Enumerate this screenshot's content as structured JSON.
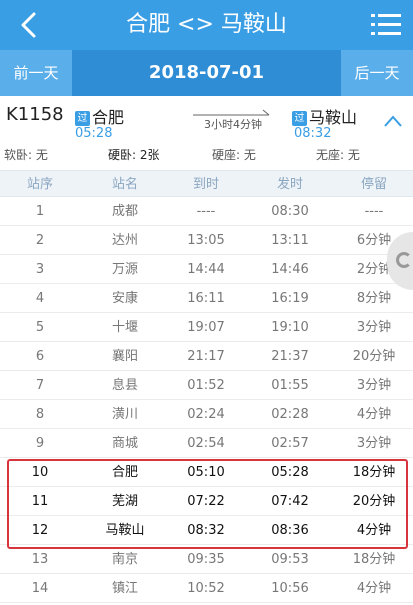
{
  "header": {
    "title": "合肥 <> 马鞍山",
    "back_icon": "chevron-left-icon",
    "menu_icon": "hamburger-menu-icon"
  },
  "datebar": {
    "prev_label": "前一天",
    "date": "2018-07-01",
    "next_label": "后一天"
  },
  "train": {
    "number": "K1158",
    "from_badge": "过",
    "from_station": "合肥",
    "from_time": "05:28",
    "duration": "3小时4分钟",
    "to_badge": "过",
    "to_station": "马鞍山",
    "to_time": "08:32",
    "seats": [
      {
        "label": "软卧: 无"
      },
      {
        "label": "硬卧: 2张"
      },
      {
        "label": "硬座: 无"
      },
      {
        "label": "无座: 无"
      }
    ]
  },
  "columns": [
    "站序",
    "站名",
    "到时",
    "发时",
    "停留"
  ],
  "stops": [
    {
      "no": "1",
      "station": "成都",
      "arrive": "----",
      "depart": "08:30",
      "stay": "----"
    },
    {
      "no": "2",
      "station": "达州",
      "arrive": "13:05",
      "depart": "13:11",
      "stay": "6分钟"
    },
    {
      "no": "3",
      "station": "万源",
      "arrive": "14:44",
      "depart": "14:46",
      "stay": "2分钟"
    },
    {
      "no": "4",
      "station": "安康",
      "arrive": "16:11",
      "depart": "16:19",
      "stay": "8分钟"
    },
    {
      "no": "5",
      "station": "十堰",
      "arrive": "19:07",
      "depart": "19:10",
      "stay": "3分钟"
    },
    {
      "no": "6",
      "station": "襄阳",
      "arrive": "21:17",
      "depart": "21:37",
      "stay": "20分钟"
    },
    {
      "no": "7",
      "station": "息县",
      "arrive": "01:52",
      "depart": "01:55",
      "stay": "3分钟"
    },
    {
      "no": "8",
      "station": "潢川",
      "arrive": "02:24",
      "depart": "02:28",
      "stay": "4分钟"
    },
    {
      "no": "9",
      "station": "商城",
      "arrive": "02:54",
      "depart": "02:57",
      "stay": "3分钟"
    },
    {
      "no": "10",
      "station": "合肥",
      "arrive": "05:10",
      "depart": "05:28",
      "stay": "18分钟"
    },
    {
      "no": "11",
      "station": "芜湖",
      "arrive": "07:22",
      "depart": "07:42",
      "stay": "20分钟"
    },
    {
      "no": "12",
      "station": "马鞍山",
      "arrive": "08:32",
      "depart": "08:36",
      "stay": "4分钟"
    },
    {
      "no": "13",
      "station": "南京",
      "arrive": "09:35",
      "depart": "09:53",
      "stay": "18分钟"
    },
    {
      "no": "14",
      "station": "镇江",
      "arrive": "10:52",
      "depart": "10:56",
      "stay": "4分钟"
    }
  ],
  "highlight_color": "#d8343b",
  "accent_color": "#3a9ee4"
}
